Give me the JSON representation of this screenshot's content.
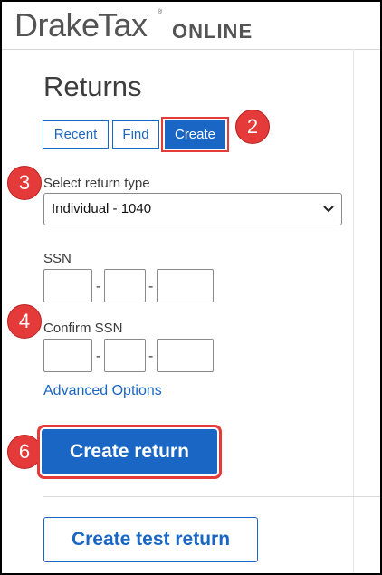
{
  "app": {
    "logo_drake": "Drake",
    "logo_tax": "Tax",
    "logo_tm": "®",
    "logo_online": "ONLINE"
  },
  "page": {
    "title": "Returns"
  },
  "tabs": [
    {
      "label": "Recent"
    },
    {
      "label": "Find"
    },
    {
      "label": "Create",
      "active": true
    }
  ],
  "form": {
    "return_type_label": "Select return type",
    "return_type_value": "Individual - 1040",
    "ssn_label": "SSN",
    "confirm_ssn_label": "Confirm SSN",
    "separator": "-",
    "advanced_options_link": "Advanced Options"
  },
  "actions": {
    "create_return": "Create return",
    "create_test_return": "Create test return"
  },
  "callouts": [
    "2",
    "3",
    "4",
    "6"
  ],
  "colors": {
    "accent": "#1a66c4",
    "callout": "#e53a3a",
    "text": "#3a3a3a"
  },
  "icons": {
    "dropdown": "chevron-down-icon"
  }
}
